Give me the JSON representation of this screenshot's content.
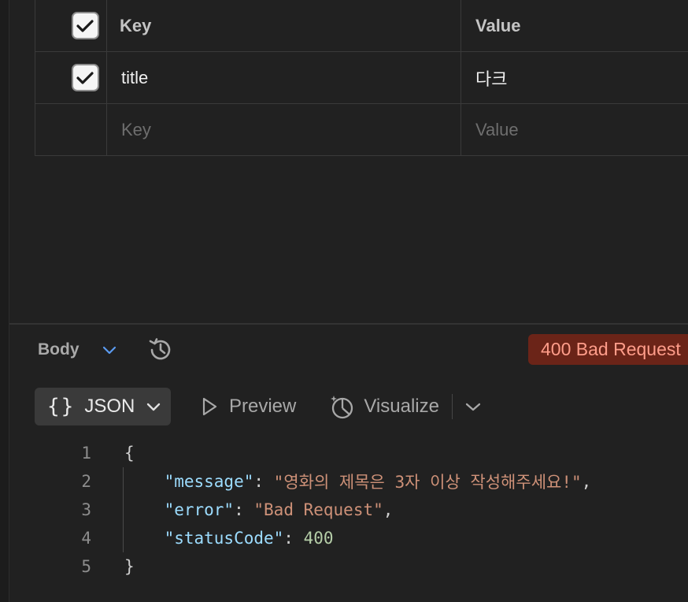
{
  "params": {
    "header": {
      "key": "Key",
      "value": "Value"
    },
    "rows": [
      {
        "key": "title",
        "value": "다크",
        "checked": true
      }
    ],
    "placeholder": {
      "key": "Key",
      "value": "Value"
    }
  },
  "response": {
    "tab_label": "Body",
    "status": "400 Bad Request",
    "status_color": "#6b2418",
    "toolbar": {
      "format": "JSON",
      "preview": "Preview",
      "visualize": "Visualize"
    },
    "code": {
      "line_numbers": [
        "1",
        "2",
        "3",
        "4",
        "5"
      ],
      "open": "{",
      "close": "}",
      "message_key": "\"message\"",
      "message_value": "\"영화의 제목은 3자 이상 작성해주세요!\"",
      "error_key": "\"error\"",
      "error_value": "\"Bad Request\"",
      "status_key": "\"statusCode\"",
      "status_value": "400"
    }
  }
}
